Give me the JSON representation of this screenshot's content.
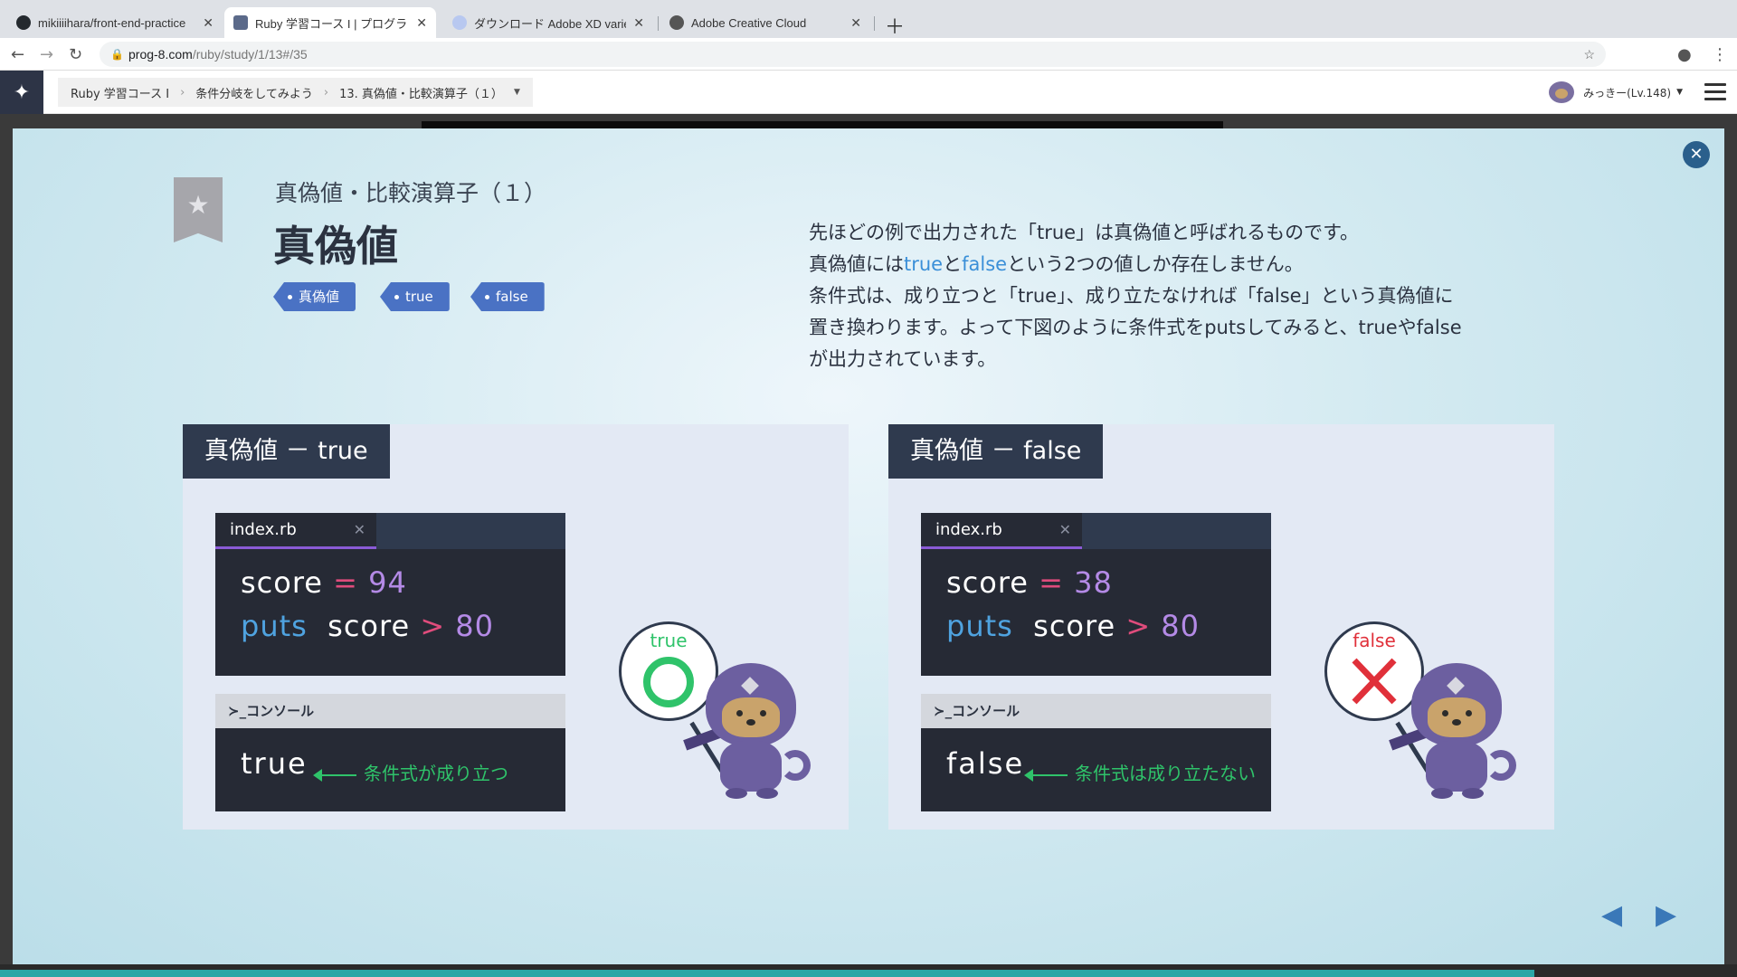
{
  "browser": {
    "tabs": [
      {
        "title": "mikiiiihara/front-end-practice",
        "icon": "github-icon"
      },
      {
        "title": "Ruby 学習コース I | プログラミン",
        "icon": "progate-icon",
        "active": true
      },
      {
        "title": "ダウンロード Adobe XD varies-v",
        "icon": "adobe-xd-icon"
      },
      {
        "title": "Adobe Creative Cloud",
        "icon": "creative-cloud-icon"
      }
    ],
    "url_host": "prog-8.com",
    "url_path": "/ruby/study/1/13#/35"
  },
  "site": {
    "breadcrumbs": [
      "Ruby 学習コース Ⅰ",
      "条件分岐をしてみよう",
      "13. 真偽値・比較演算子（１）"
    ],
    "user": "みっきー(Lv.148)"
  },
  "slide": {
    "subtitle": "真偽値・比較演算子（１）",
    "title": "真偽値",
    "tags": [
      "真偽値",
      "true",
      "false"
    ],
    "desc": {
      "l1": "先ほどの例で出力された「true」は真偽値と呼ばれるものです。",
      "l2_a": "真偽値には",
      "l2_true": "true",
      "l2_b": "と",
      "l2_false": "false",
      "l2_c": "という2つの値しか存在しません。",
      "l3": "条件式は、成り立つと「true」、成り立たなければ「false」という真偽値に",
      "l4": "置き換わります。よって下図のように条件式をputsしてみると、trueやfalse",
      "l5": "が出力されています。"
    },
    "panels": [
      {
        "heading": "真偽値 － true",
        "file": "index.rb",
        "var": "score",
        "eq": "=",
        "value": "94",
        "puts": "puts",
        "var2": "score",
        "cmp": ">",
        "threshold": "80",
        "console_label": "コンソール",
        "output": "true",
        "note": "条件式が成り立つ",
        "sign": "true",
        "sign_color": "#2fc36a"
      },
      {
        "heading": "真偽値 － false",
        "file": "index.rb",
        "var": "score",
        "eq": "=",
        "value": "38",
        "puts": "puts",
        "var2": "score",
        "cmp": ">",
        "threshold": "80",
        "console_label": "コンソール",
        "output": "false",
        "note": "条件式は成り立たない",
        "sign": "false",
        "sign_color": "#e0303a"
      }
    ]
  },
  "colors": {
    "accent": "#4a72c4",
    "header_dark": "#2f3a4e",
    "green": "#2fc36a",
    "red": "#e0303a"
  }
}
